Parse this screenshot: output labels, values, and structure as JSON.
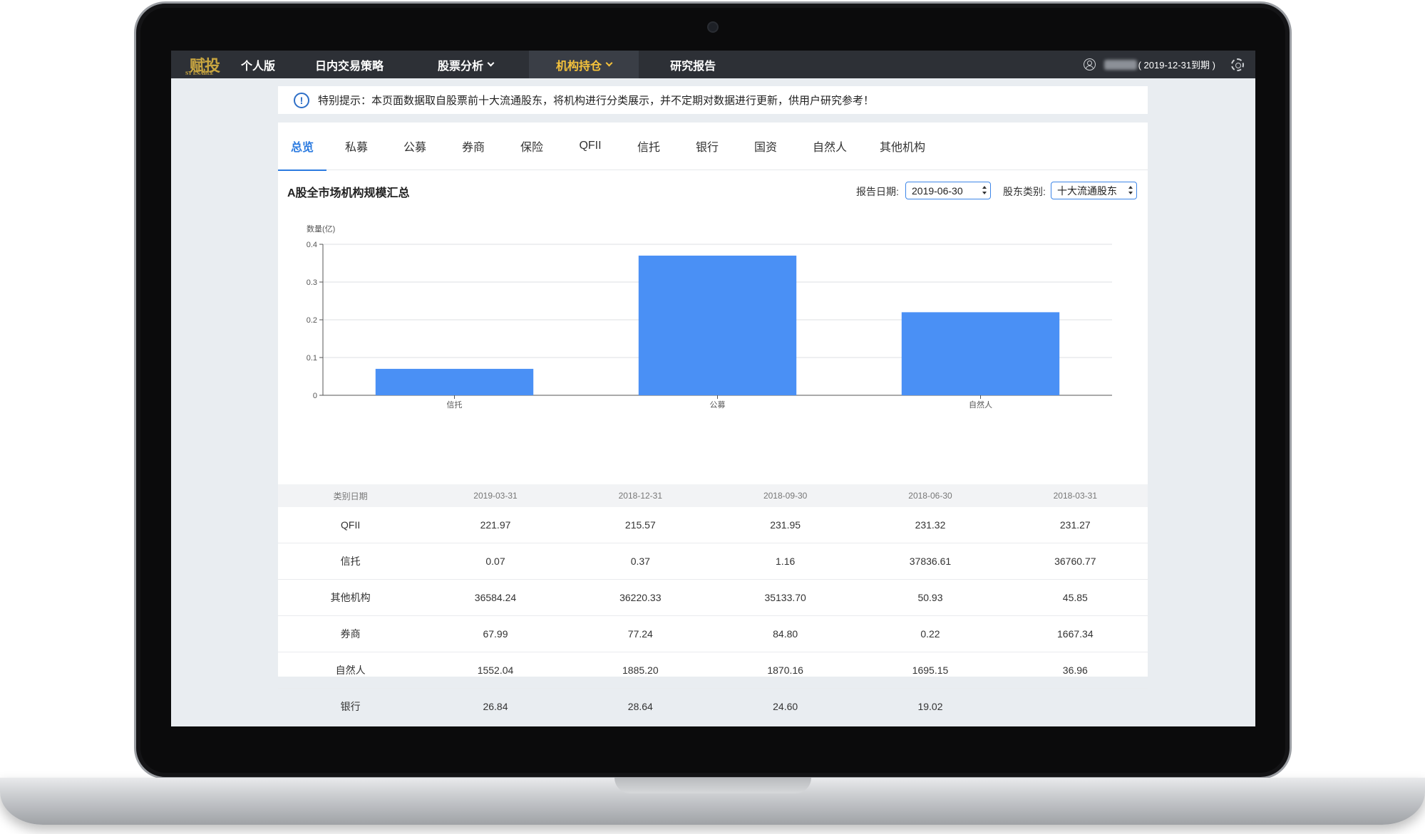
{
  "nav": {
    "logo_text": "赋投",
    "logo_sub": "SY ENABLE",
    "items": [
      {
        "label": "个人版"
      },
      {
        "label": "日内交易策略"
      },
      {
        "label": "股票分析"
      },
      {
        "label": "机构持仓"
      },
      {
        "label": "研究报告"
      }
    ],
    "expiry": "( 2019-12-31到期 )"
  },
  "notice": {
    "text": "特别提示：本页面数据取自股票前十大流通股东，将机构进行分类展示，并不定期对数据进行更新，供用户研究参考！"
  },
  "tabs": [
    "总览",
    "私募",
    "公募",
    "券商",
    "保险",
    "QFII",
    "信托",
    "银行",
    "国资",
    "自然人",
    "其他机构"
  ],
  "section": {
    "title": "A股全市场机构规模汇总",
    "report_date_label": "报告日期:",
    "report_date_value": "2019-06-30",
    "holder_type_label": "股东类别:",
    "holder_type_value": "十大流通股东"
  },
  "chart_data": {
    "type": "bar",
    "ylabel": "数量(亿)",
    "categories": [
      "信托",
      "公募",
      "自然人"
    ],
    "values": [
      0.07,
      0.37,
      0.22
    ],
    "ylim": [
      0,
      0.4
    ],
    "yticks": [
      "0",
      "0.1",
      "0.2",
      "0.3",
      "0.4"
    ],
    "grid": true,
    "color": "#4a90f5"
  },
  "table": {
    "headers": [
      "类别日期",
      "2019-03-31",
      "2018-12-31",
      "2018-09-30",
      "2018-06-30",
      "2018-03-31"
    ],
    "rows": [
      [
        "QFII",
        "221.97",
        "215.57",
        "231.95",
        "231.32",
        "231.27"
      ],
      [
        "信托",
        "0.07",
        "0.37",
        "1.16",
        "37836.61",
        "36760.77"
      ],
      [
        "其他机构",
        "36584.24",
        "36220.33",
        "35133.70",
        "50.93",
        "45.85"
      ],
      [
        "券商",
        "67.99",
        "77.24",
        "84.80",
        "0.22",
        "1667.34"
      ],
      [
        "自然人",
        "1552.04",
        "1885.20",
        "1870.16",
        "1695.15",
        "36.96"
      ],
      [
        "银行",
        "26.84",
        "28.64",
        "24.60",
        "19.02",
        ""
      ]
    ]
  }
}
